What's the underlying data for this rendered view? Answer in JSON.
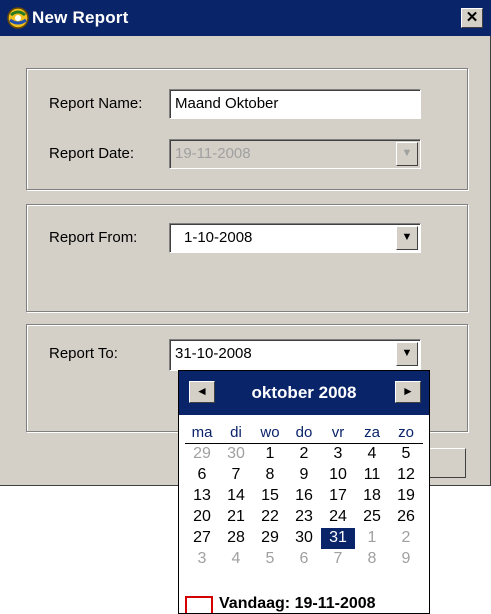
{
  "window": {
    "title": "New Report",
    "close_label": "✕"
  },
  "report_name": {
    "label": "Report Name:",
    "value": "Maand Oktober"
  },
  "report_date": {
    "label": "Report Date:",
    "value": "19-11-2008"
  },
  "report_from": {
    "label": "Report From:",
    "value": "1-10-2008"
  },
  "report_to": {
    "label": "Report To:",
    "value": "31-10-2008"
  },
  "calendar": {
    "month_label": "oktober 2008",
    "prev_icon": "◄",
    "next_icon": "►",
    "weekdays": [
      "ma",
      "di",
      "wo",
      "do",
      "vr",
      "za",
      "zo"
    ],
    "weeks": [
      [
        "29",
        "30",
        "1",
        "2",
        "3",
        "4",
        "5"
      ],
      [
        "6",
        "7",
        "8",
        "9",
        "10",
        "11",
        "12"
      ],
      [
        "13",
        "14",
        "15",
        "16",
        "17",
        "18",
        "19"
      ],
      [
        "20",
        "21",
        "22",
        "23",
        "24",
        "25",
        "26"
      ],
      [
        "27",
        "28",
        "29",
        "30",
        "31",
        "1",
        "2"
      ],
      [
        "3",
        "4",
        "5",
        "6",
        "7",
        "8",
        "9"
      ]
    ],
    "selected_day": "31",
    "today_label": "Vandaag: 19-11-2008",
    "colors": {
      "header": "#0a246a",
      "selected": "#0a246a",
      "today_box": "#d40000",
      "muted": "#a0a0a0"
    }
  }
}
